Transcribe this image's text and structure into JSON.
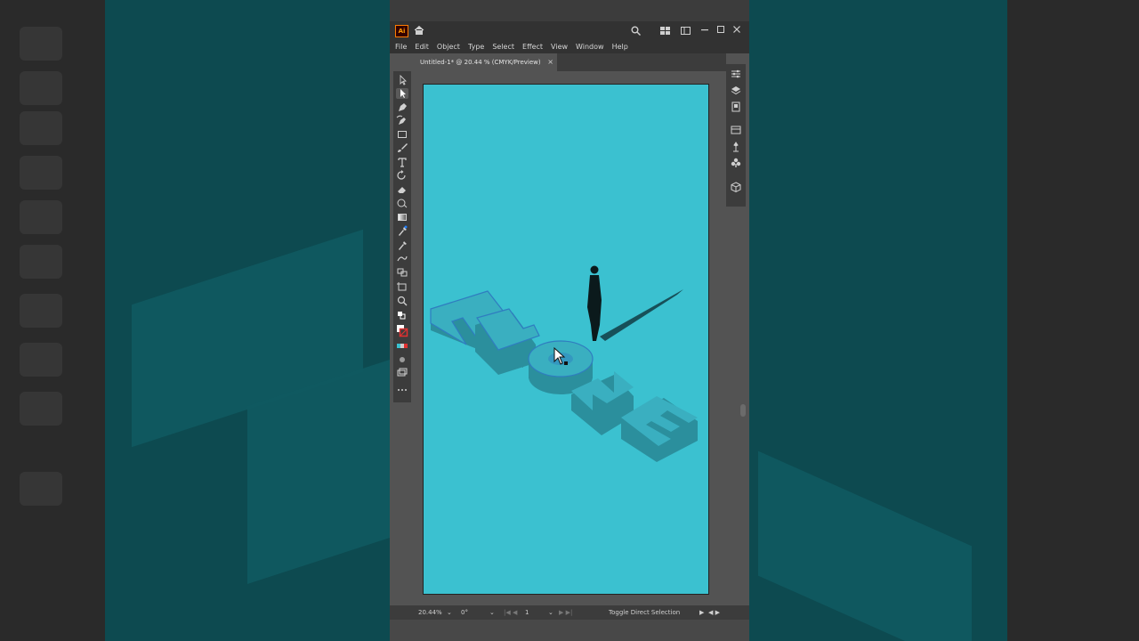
{
  "app": {
    "logo": "Ai",
    "menu": [
      "File",
      "Edit",
      "Object",
      "Type",
      "Select",
      "Effect",
      "View",
      "Window",
      "Help"
    ],
    "document_tab": "Untitled-1* @ 20.44 % (CMYK/Preview)",
    "tab_close": "×",
    "icons": {
      "home": "home-icon",
      "search": "search-icon",
      "arrange": "arrange-documents-icon",
      "minimize": "minimize-icon",
      "maximize": "maximize-icon",
      "close": "close-icon"
    }
  },
  "artwork": {
    "word": "ALONE",
    "colors": {
      "artboard": "#3bc1d0",
      "letter_top": "#3aafc0",
      "letter_side": "#2b8f9d",
      "figure": "#0b1a1c"
    }
  },
  "toolbar": {
    "tools": [
      "selection-tool",
      "direct-selection-tool",
      "pen-tool",
      "curvature-tool",
      "rectangle-tool",
      "paintbrush-tool",
      "type-tool",
      "rotate-tool",
      "eraser-tool",
      "shape-builder-tool",
      "gradient-tool",
      "eyedropper-tool",
      "blend-tool",
      "puppet-warp-tool",
      "symbol-sprayer-tool",
      "artboard-tool",
      "zoom-tool",
      "more-tools"
    ]
  },
  "status": {
    "zoom": "20.44%",
    "rotation": "0°",
    "artboard_number": "1",
    "message": "Toggle Direct Selection"
  }
}
